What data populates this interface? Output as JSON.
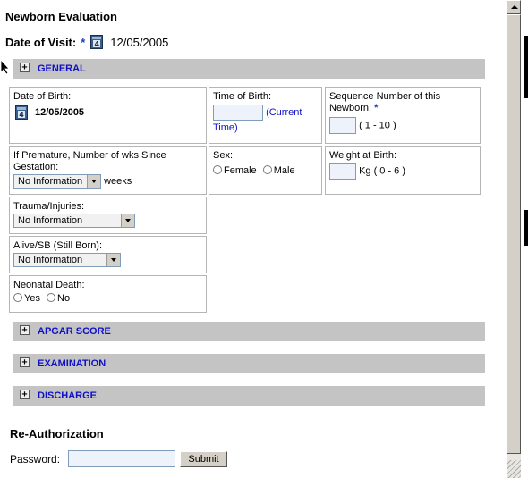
{
  "page": {
    "title": "Newborn Evaluation",
    "visit_label": "Date of Visit:",
    "visit_required": "*",
    "visit_date": "12/05/2005",
    "calendar_day": "4"
  },
  "sections": {
    "general": "GENERAL",
    "apgar": "APGAR SCORE",
    "examination": "EXAMINATION",
    "discharge": "DISCHARGE",
    "toggle_symbol": "+"
  },
  "general": {
    "dob_label": "Date of Birth:",
    "dob_value": "12/05/2005",
    "tob_label": "Time of Birth:",
    "tob_hint": "(Current Time)",
    "seq_label": "Sequence Number of this Newborn:",
    "seq_required": "*",
    "seq_range": "( 1 - 10 )",
    "premature_label": "If Premature, Number of wks Since Gestation:",
    "premature_value": "No Information",
    "premature_unit": "weeks",
    "sex_label": "Sex:",
    "sex_female": "Female",
    "sex_male": "Male",
    "weight_label": "Weight at Birth:",
    "weight_unit": "Kg ( 0 - 6 )",
    "trauma_label": "Trauma/Injuries:",
    "trauma_value": "No Information",
    "alive_label": "Alive/SB (Still Born):",
    "alive_value": "No Information",
    "neonatal_label": "Neonatal Death:",
    "neonatal_yes": "Yes",
    "neonatal_no": "No"
  },
  "reauth": {
    "title": "Re-Authorization",
    "password_label": "Password:",
    "submit_label": "Submit"
  },
  "colors": {
    "section_bar": "#c4c4c4",
    "section_title": "#1010c8",
    "hint": "#1010c8"
  }
}
